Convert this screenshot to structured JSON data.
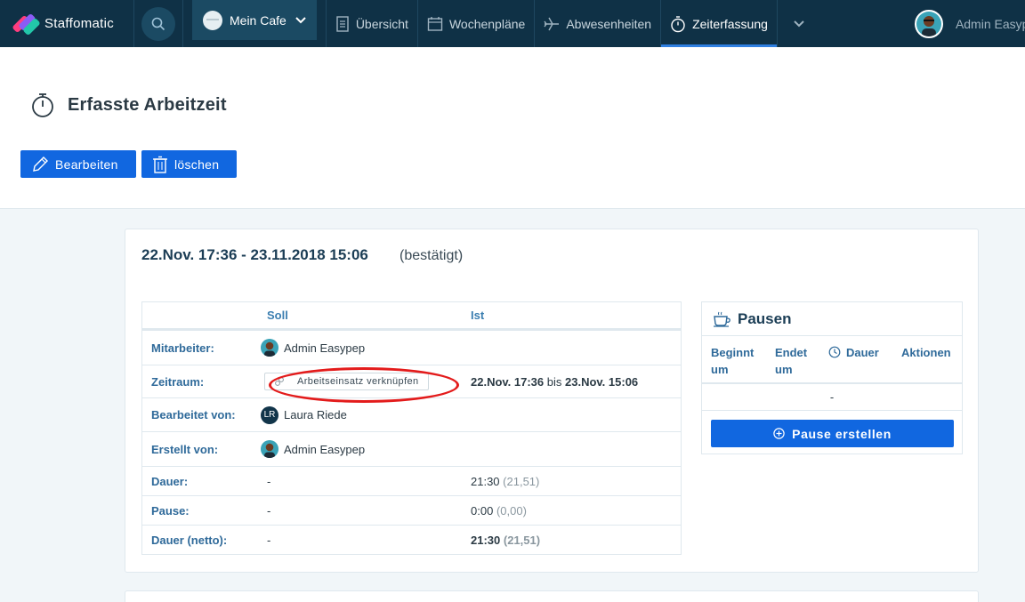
{
  "nav": {
    "brand": "Staffomatic",
    "workspace": "Mein Cafe",
    "items": [
      {
        "label": "Übersicht",
        "icon": "document-icon"
      },
      {
        "label": "Wochenpläne",
        "icon": "calendar-icon"
      },
      {
        "label": "Abwesenheiten",
        "icon": "plane-icon"
      },
      {
        "label": "Zeiterfassung",
        "icon": "stopwatch-icon",
        "active": true
      }
    ],
    "user_name": "Admin Easypep"
  },
  "header": {
    "title": "Erfasste Arbeitzeit",
    "edit_label": "Bearbeiten",
    "delete_label": "löschen"
  },
  "record": {
    "title": "22.Nov. 17:36 - 23.11.2018 15:06",
    "status": "(bestätigt)",
    "col_soll": "Soll",
    "col_ist": "Ist",
    "rows": {
      "employee": {
        "label": "Mitarbeiter:",
        "soll": "Admin Easypep"
      },
      "period": {
        "label": "Zeitraum:",
        "link_button": "Arbeitseinsatz verknüpfen",
        "ist_start": "22.Nov. 17:36",
        "ist_between": "bis",
        "ist_end": "23.Nov. 15:06"
      },
      "edited_by": {
        "label": "Bearbeitet von:",
        "initials": "LR",
        "soll": "Laura Riede"
      },
      "created_by": {
        "label": "Erstellt von:",
        "soll": "Admin Easypep"
      },
      "duration": {
        "label": "Dauer:",
        "soll": "-",
        "ist": "21:30",
        "ist_decimal": "(21,51)"
      },
      "pause": {
        "label": "Pause:",
        "soll": "-",
        "ist": "0:00",
        "ist_decimal": "(0,00)"
      },
      "net": {
        "label": "Dauer (netto):",
        "soll": "-",
        "ist": "21:30",
        "ist_decimal": "(21,51)"
      }
    }
  },
  "pausen": {
    "title": "Pausen",
    "col_begin": "Beginnt um",
    "col_end": "Endet um",
    "col_duration": "Dauer",
    "col_actions": "Aktionen",
    "empty": "-",
    "create_label": "Pause erstellen"
  },
  "colors": {
    "nav_bg": "#0f3146",
    "accent": "#1167e0",
    "active_underline": "#2f7fe0",
    "annotation": "#e31b1b"
  }
}
